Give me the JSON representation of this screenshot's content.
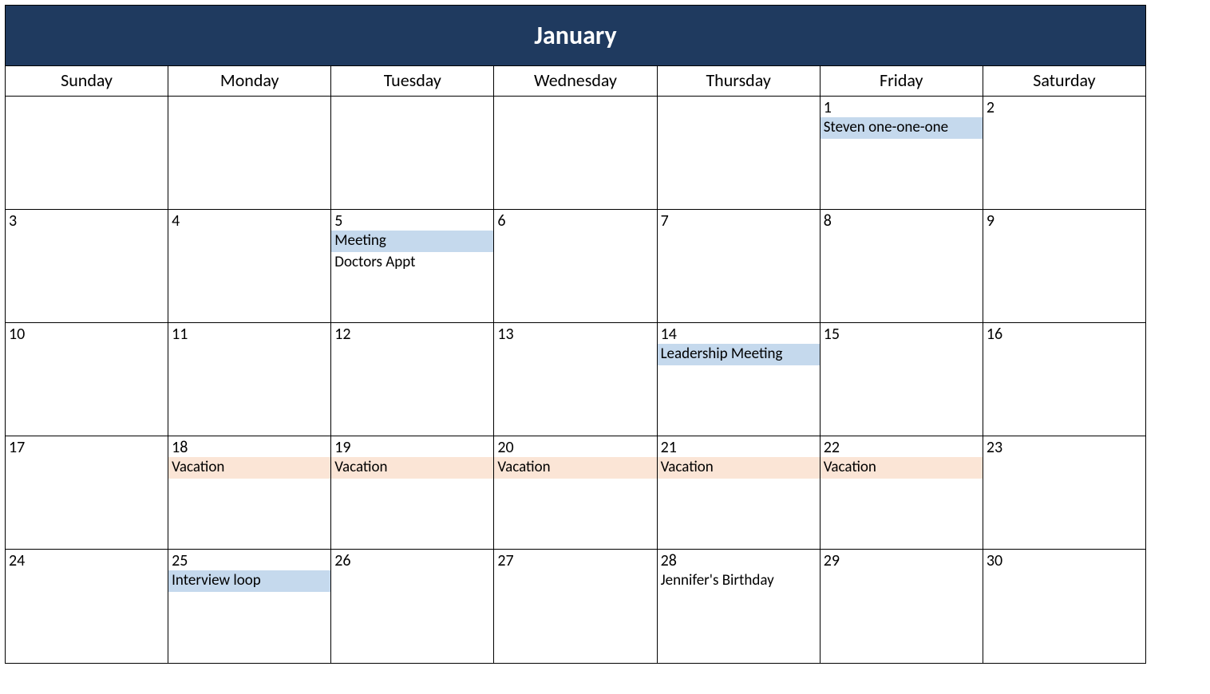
{
  "month_title": "January",
  "weekdays": [
    "Sunday",
    "Monday",
    "Tuesday",
    "Wednesday",
    "Thursday",
    "Friday",
    "Saturday"
  ],
  "colors": {
    "header_bg": "#1f3a5f",
    "event_blue": "#c5d9ed",
    "event_peach": "#fbe5d6"
  },
  "weeks": [
    [
      {
        "day": "",
        "events": []
      },
      {
        "day": "",
        "events": []
      },
      {
        "day": "",
        "events": []
      },
      {
        "day": "",
        "events": []
      },
      {
        "day": "",
        "events": []
      },
      {
        "day": "1",
        "events": [
          {
            "label": "Steven one-one-one",
            "color": "blue"
          }
        ]
      },
      {
        "day": "2",
        "events": []
      }
    ],
    [
      {
        "day": "3",
        "events": []
      },
      {
        "day": "4",
        "events": []
      },
      {
        "day": "5",
        "events": [
          {
            "label": "Meeting",
            "color": "blue"
          },
          {
            "label": "Doctors Appt",
            "color": "plain"
          }
        ]
      },
      {
        "day": "6",
        "events": []
      },
      {
        "day": "7",
        "events": []
      },
      {
        "day": "8",
        "events": []
      },
      {
        "day": "9",
        "events": []
      }
    ],
    [
      {
        "day": "10",
        "events": []
      },
      {
        "day": "11",
        "events": []
      },
      {
        "day": "12",
        "events": []
      },
      {
        "day": "13",
        "events": []
      },
      {
        "day": "14",
        "events": [
          {
            "label": "Leadership Meeting",
            "color": "blue"
          }
        ]
      },
      {
        "day": "15",
        "events": []
      },
      {
        "day": "16",
        "events": []
      }
    ],
    [
      {
        "day": "17",
        "events": []
      },
      {
        "day": "18",
        "events": [
          {
            "label": "Vacation",
            "color": "peach"
          }
        ]
      },
      {
        "day": "19",
        "events": [
          {
            "label": "Vacation",
            "color": "peach"
          }
        ]
      },
      {
        "day": "20",
        "events": [
          {
            "label": "Vacation",
            "color": "peach"
          }
        ]
      },
      {
        "day": "21",
        "events": [
          {
            "label": "Vacation",
            "color": "peach"
          }
        ]
      },
      {
        "day": "22",
        "events": [
          {
            "label": "Vacation",
            "color": "peach"
          }
        ]
      },
      {
        "day": "23",
        "events": []
      }
    ],
    [
      {
        "day": "24",
        "events": []
      },
      {
        "day": "25",
        "events": [
          {
            "label": "Interview loop",
            "color": "blue"
          }
        ]
      },
      {
        "day": "26",
        "events": []
      },
      {
        "day": "27",
        "events": []
      },
      {
        "day": "28",
        "events": [
          {
            "label": "Jennifer's Birthday",
            "color": "plain"
          }
        ]
      },
      {
        "day": "29",
        "events": []
      },
      {
        "day": "30",
        "events": []
      }
    ]
  ]
}
